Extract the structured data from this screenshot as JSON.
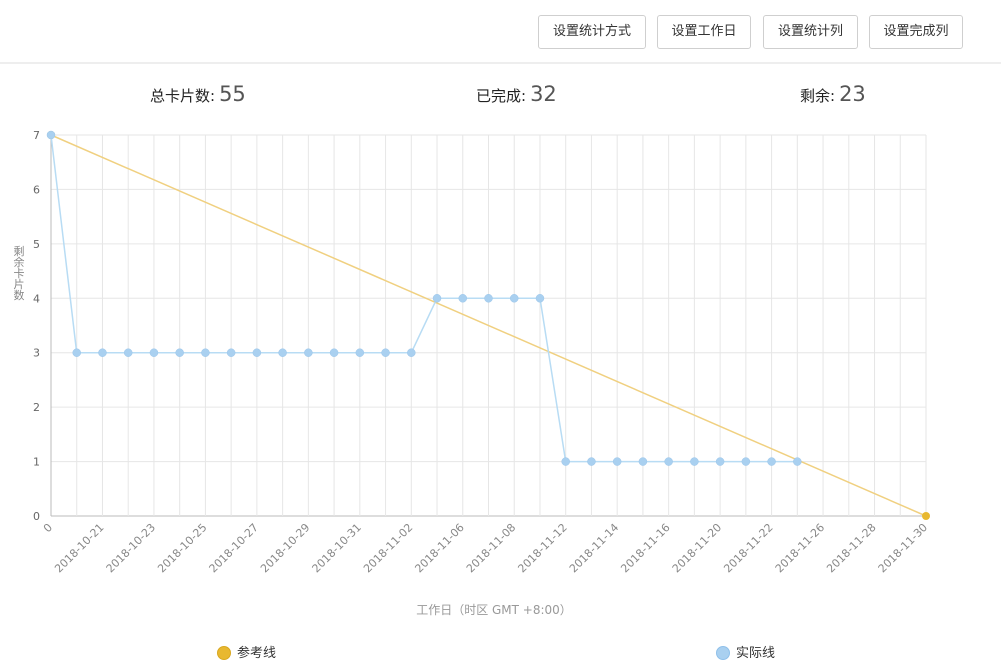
{
  "toolbar": {
    "btn_stat_method": "设置统计方式",
    "btn_workdays": "设置工作日",
    "btn_stat_columns": "设置统计列",
    "btn_done_column": "设置完成列"
  },
  "stats": {
    "total_label": "总卡片数:",
    "total_value": "55",
    "done_label": "已完成:",
    "done_value": "32",
    "remain_label": "剩余:",
    "remain_value": "23"
  },
  "legend": {
    "reference_label": "参考线",
    "actual_label": "实际线"
  },
  "colors": {
    "reference": "#f0d080",
    "reference_dot": "#e8b830",
    "actual": "#b8dcf4",
    "actual_dot": "#a9d0f0",
    "grid": "#e6e6e6"
  },
  "chart_data": {
    "type": "line",
    "ylabel": "剩余卡片数",
    "xlabel": "工作日（时区 GMT +8:00）",
    "ylim": [
      0,
      7
    ],
    "yticks": [
      0,
      1,
      2,
      3,
      4,
      5,
      6,
      7
    ],
    "grid": true,
    "legend_position": "bottom",
    "x": [
      "0",
      "2018-10-20",
      "2018-10-21",
      "2018-10-22",
      "2018-10-23",
      "2018-10-24",
      "2018-10-25",
      "2018-10-26",
      "2018-10-27",
      "2018-10-28",
      "2018-10-29",
      "2018-10-30",
      "2018-10-31",
      "2018-11-01",
      "2018-11-02",
      "2018-11-05",
      "2018-11-06",
      "2018-11-07",
      "2018-11-08",
      "2018-11-09",
      "2018-11-12",
      "2018-11-13",
      "2018-11-14",
      "2018-11-15",
      "2018-11-16",
      "2018-11-19",
      "2018-11-20",
      "2018-11-21",
      "2018-11-22",
      "2018-11-23",
      "2018-11-26",
      "2018-11-27",
      "2018-11-28",
      "2018-11-29",
      "2018-11-30"
    ],
    "tick_labels": [
      "0",
      "2018-10-21",
      "2018-10-23",
      "2018-10-25",
      "2018-10-27",
      "2018-10-29",
      "2018-10-31",
      "2018-11-02",
      "2018-11-06",
      "2018-11-08",
      "2018-11-12",
      "2018-11-14",
      "2018-11-16",
      "2018-11-20",
      "2018-11-22",
      "2018-11-26",
      "2018-11-28",
      "2018-11-30"
    ],
    "series": [
      {
        "name": "参考线",
        "points": [
          {
            "x": "0",
            "y": 7
          },
          {
            "x": "2018-11-30",
            "y": 0
          }
        ]
      },
      {
        "name": "实际线",
        "points": [
          {
            "x": "0",
            "y": 7
          },
          {
            "x": "2018-10-20",
            "y": 3
          },
          {
            "x": "2018-10-21",
            "y": 3
          },
          {
            "x": "2018-10-22",
            "y": 3
          },
          {
            "x": "2018-10-23",
            "y": 3
          },
          {
            "x": "2018-10-24",
            "y": 3
          },
          {
            "x": "2018-10-25",
            "y": 3
          },
          {
            "x": "2018-10-26",
            "y": 3
          },
          {
            "x": "2018-10-27",
            "y": 3
          },
          {
            "x": "2018-10-28",
            "y": 3
          },
          {
            "x": "2018-10-29",
            "y": 3
          },
          {
            "x": "2018-10-30",
            "y": 3
          },
          {
            "x": "2018-10-31",
            "y": 3
          },
          {
            "x": "2018-11-01",
            "y": 3
          },
          {
            "x": "2018-11-02",
            "y": 3
          },
          {
            "x": "2018-11-05",
            "y": 4
          },
          {
            "x": "2018-11-06",
            "y": 4
          },
          {
            "x": "2018-11-07",
            "y": 4
          },
          {
            "x": "2018-11-08",
            "y": 4
          },
          {
            "x": "2018-11-09",
            "y": 4
          },
          {
            "x": "2018-11-12",
            "y": 1
          },
          {
            "x": "2018-11-13",
            "y": 1
          },
          {
            "x": "2018-11-14",
            "y": 1
          },
          {
            "x": "2018-11-15",
            "y": 1
          },
          {
            "x": "2018-11-16",
            "y": 1
          },
          {
            "x": "2018-11-19",
            "y": 1
          },
          {
            "x": "2018-11-20",
            "y": 1
          },
          {
            "x": "2018-11-21",
            "y": 1
          },
          {
            "x": "2018-11-22",
            "y": 1
          },
          {
            "x": "2018-11-23",
            "y": 1
          }
        ]
      }
    ]
  }
}
